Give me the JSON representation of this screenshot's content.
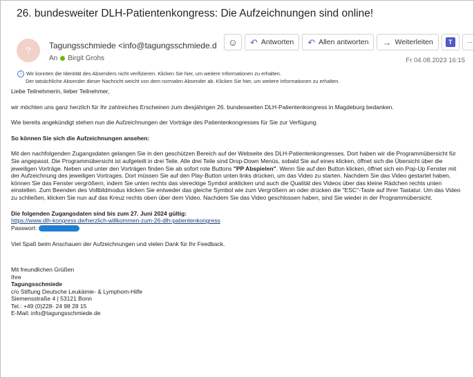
{
  "email": {
    "subject": "26. bundesweiter DLH-Patientenkongress: Die Aufzeichnungen sind online!",
    "avatar_initial": "?",
    "sender": "Tagungsschmiede <info@tagungsschmiede.d",
    "to_label": "An",
    "recipient": "Birgit Grohs",
    "date": "Fr 04.08.2023 16:15",
    "warning_line1": "Wir konnten die Identität des Absenders nicht verifizieren. Klicken Sie hier, um weitere Informationen zu erhalten.",
    "warning_line2": "Der tatsächliche Absender dieser Nachricht weicht von dem normalen Absender ab. Klicken Sie hier, um weitere Informationen zu erhalten."
  },
  "toolbar": {
    "emoji_icon": "☺",
    "reply_label": "Antworten",
    "reply_all_label": "Allen antworten",
    "forward_label": "Weiterleiten",
    "teams_icon": "T",
    "more_label": "···"
  },
  "body": {
    "greeting": "Liebe Teilnehmerin, lieber Teilnehmer,",
    "p1": "wir möchten uns ganz herzlich für Ihr zahlreiches Erscheinen zum diesjährigen 26. bundesweiten DLH-Patientenkongress in Magdeburg bedanken.",
    "p2": "Wie bereits angekündigt stehen nun die Aufzeichnungen der Vorträge des Patientenkongresses für Sie zur Verfügung.",
    "heading1": "So können Sie sich die Aufzeichnungen ansehen:",
    "p3a": "Mit den nachfolgenden Zugangsdaten gelangen Sie in den geschützen Bereich auf der Webseite des DLH-Patientenkongresses. Dort haben wir die Programmübersicht für Sie angepasst. Die Programmübersicht ist aufgeteilt in drei Teile. Alle drei Teile sind Drop-Down Menüs, sobald Sie auf eines klicken, öffnet sich die Übersicht über die jeweiligen Vorträge. Neben und unter den Vorträgen finden Sie ab sofort rote Buttons ",
    "p3b": "\"PP Abspielen\"",
    "p3c": ". Wenn Sie auf den Button klicken, öffnet sich ein Pop-Up Fenster mit der Aufzeichnung des jeweiligen Vortrages. Dort müssen Sie auf den Play-Button unten links drücken, um das Video zu starten. Nachdem Sie das Video gestartet haben, können Sie das Fenster vergrößern, indem Sie unten rechts das viereckige Symbol anklicken und auch die Qualität des Videos über das kleine Rädchen rechts unten einstellen. Zum Beenden des Vollbildmodus klicken Sie entweder das gleiche Symbol wie zum Vergrößern an oder drücken die \"ESC\"-Taste auf Ihrer Tastatur. Um das Video zu schließen, klicken Sie nun auf das Kreuz rechts oben über dem Video. Nachdem Sie das Video geschlossen haben, sind Sie wieder in der Programmübersicht.",
    "heading2": "Die folgenden Zugangsdaten sind bis zum 27. Juni 2024 gültig:",
    "link": "https://www.dlh-kongress.de/herzlich-willkommen-zum-26-dlh-patientenkongress",
    "password_label": "Passwort:",
    "closing": "Viel Spaß beim Anschauen der Aufzeichnungen und vielen Dank für Ihr Feedback.",
    "regards": "Mit freundlichen Grüßen",
    "yours": "Ihre",
    "org": "Tagungsschmiede",
    "addr1": "c/o Stiftung Deutsche Leukämie- & Lymphom-Hilfe",
    "addr2": "Siemensstraße 4 | 53121 Bonn",
    "phone": "Tel.: +49 (0)228- 24 98 28 15",
    "email_line": "E-Mail: info@tagungsschmiede.de"
  }
}
